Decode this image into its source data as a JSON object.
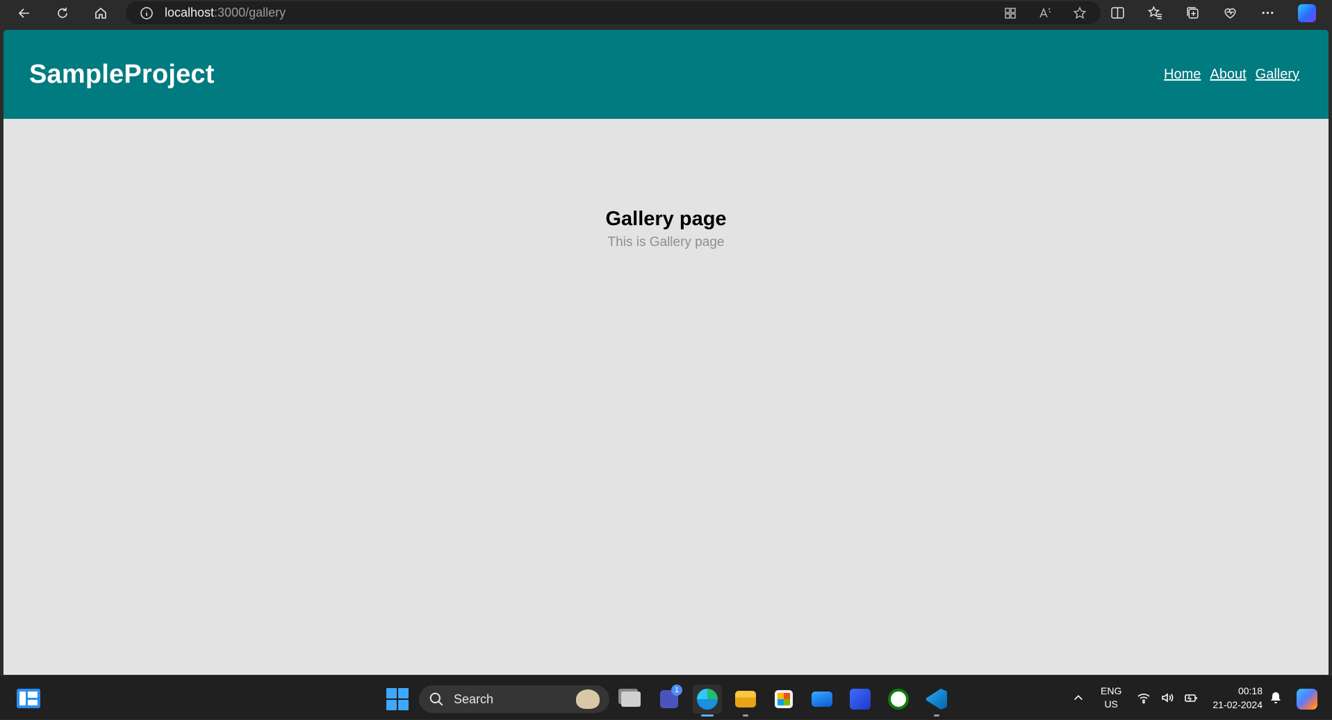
{
  "browser": {
    "url_host": "localhost",
    "url_rest": ":3000/gallery"
  },
  "site": {
    "logo": "SampleProject",
    "nav": [
      {
        "label": "Home"
      },
      {
        "label": "About"
      },
      {
        "label": "Gallery"
      }
    ],
    "header_color": "#007b80"
  },
  "page": {
    "heading": "Gallery page",
    "subtext": "This is Gallery page"
  },
  "taskbar": {
    "search_label": "Search",
    "teams_badge": "1",
    "lang_line1": "ENG",
    "lang_line2": "US",
    "time": "00:18",
    "date": "21-02-2024",
    "apps": [
      {
        "name": "task-view"
      },
      {
        "name": "teams"
      },
      {
        "name": "edge",
        "active": true
      },
      {
        "name": "file-explorer"
      },
      {
        "name": "microsoft-store"
      },
      {
        "name": "mail"
      },
      {
        "name": "app"
      },
      {
        "name": "xbox"
      },
      {
        "name": "vscode"
      }
    ]
  }
}
